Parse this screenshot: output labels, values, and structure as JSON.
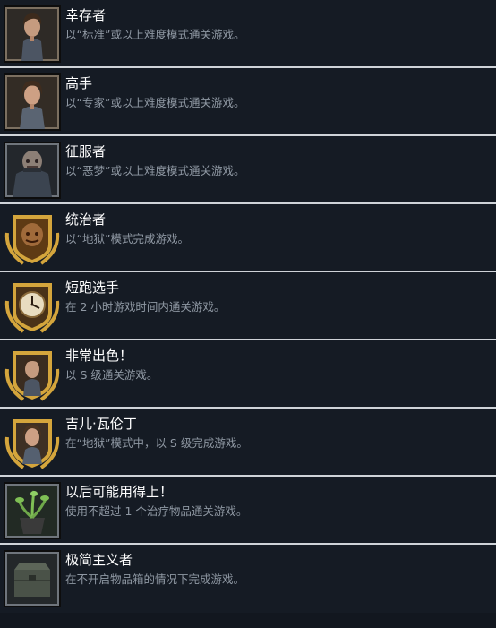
{
  "achievements": [
    {
      "title": "幸存者",
      "description": "以“标准”或以上难度模式通关游戏。",
      "icon": "jill-portrait-icon"
    },
    {
      "title": "高手",
      "description": "以“专家”或以上难度模式通关游戏。",
      "icon": "jill-portrait-icon"
    },
    {
      "title": "征服者",
      "description": "以“恶梦”或以上难度模式通关游戏。",
      "icon": "nemesis-portrait-icon"
    },
    {
      "title": "统治者",
      "description": "以“地狱”模式完成游戏。",
      "icon": "nemesis-laurel-icon"
    },
    {
      "title": "短跑选手",
      "description": "在 2 小时游戏时间内通关游戏。",
      "icon": "clock-laurel-icon"
    },
    {
      "title": "非常出色！",
      "description": "以 S 级通关游戏。",
      "icon": "jill-laurel-icon"
    },
    {
      "title": "吉儿·瓦伦丁",
      "description": "在“地狱”模式中，以 S 级完成游戏。",
      "icon": "jill-laurel-icon"
    },
    {
      "title": "以后可能用得上！",
      "description": "使用不超过 1 个治疗物品通关游戏。",
      "icon": "green-herb-icon"
    },
    {
      "title": "极简主义者",
      "description": "在不开启物品箱的情况下完成游戏。",
      "icon": "item-box-icon"
    }
  ],
  "colors": {
    "background": "#12171f",
    "row_background": "#151b24",
    "divider": "#cfd3d8",
    "title_text": "#ffffff",
    "description_text": "#8f98a3",
    "gold": "#d4a53c"
  }
}
